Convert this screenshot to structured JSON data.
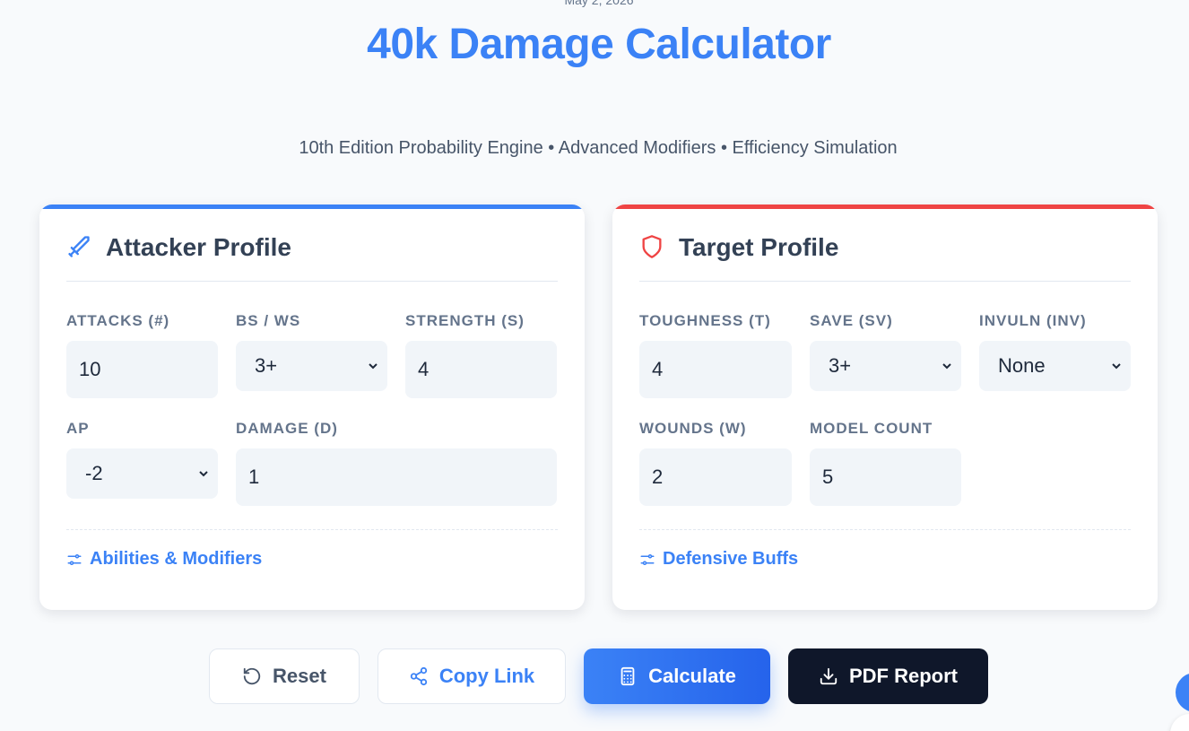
{
  "header": {
    "date": "May 2, 2026",
    "title": "40k Damage Calculator",
    "subtitle": "10th Edition Probability Engine • Advanced Modifiers • Efficiency Simulation"
  },
  "attacker": {
    "title": "Attacker Profile",
    "fields": {
      "attacks": {
        "label": "ATTACKS (#)",
        "value": "10"
      },
      "bs_ws": {
        "label": "BS / WS",
        "value": "3+"
      },
      "strength": {
        "label": "STRENGTH (S)",
        "value": "4"
      },
      "ap": {
        "label": "AP",
        "value": "-2"
      },
      "damage": {
        "label": "DAMAGE (D)",
        "value": "1"
      }
    },
    "modifiers_link": "Abilities & Modifiers"
  },
  "target": {
    "title": "Target Profile",
    "fields": {
      "toughness": {
        "label": "TOUGHNESS (T)",
        "value": "4"
      },
      "save": {
        "label": "SAVE (SV)",
        "value": "3+"
      },
      "invuln": {
        "label": "INVULN (INV)",
        "value": "None"
      },
      "wounds": {
        "label": "WOUNDS (W)",
        "value": "2"
      },
      "model_count": {
        "label": "MODEL COUNT",
        "value": "5"
      }
    },
    "buffs_link": "Defensive Buffs"
  },
  "actions": {
    "reset": "Reset",
    "copy_link": "Copy Link",
    "calculate": "Calculate",
    "pdf_report": "PDF Report"
  },
  "icons": {
    "attacker": "sword-icon",
    "target": "shield-icon",
    "modifiers": "sliders-icon",
    "reset": "rotate-ccw-icon",
    "copy": "share-icon",
    "calculate": "calculator-icon",
    "pdf": "download-icon"
  },
  "colors": {
    "accent": "#3b82f6",
    "attacker_bar": "#3b82f6",
    "target_bar": "#ef4444",
    "dark_button": "#0f172a"
  }
}
